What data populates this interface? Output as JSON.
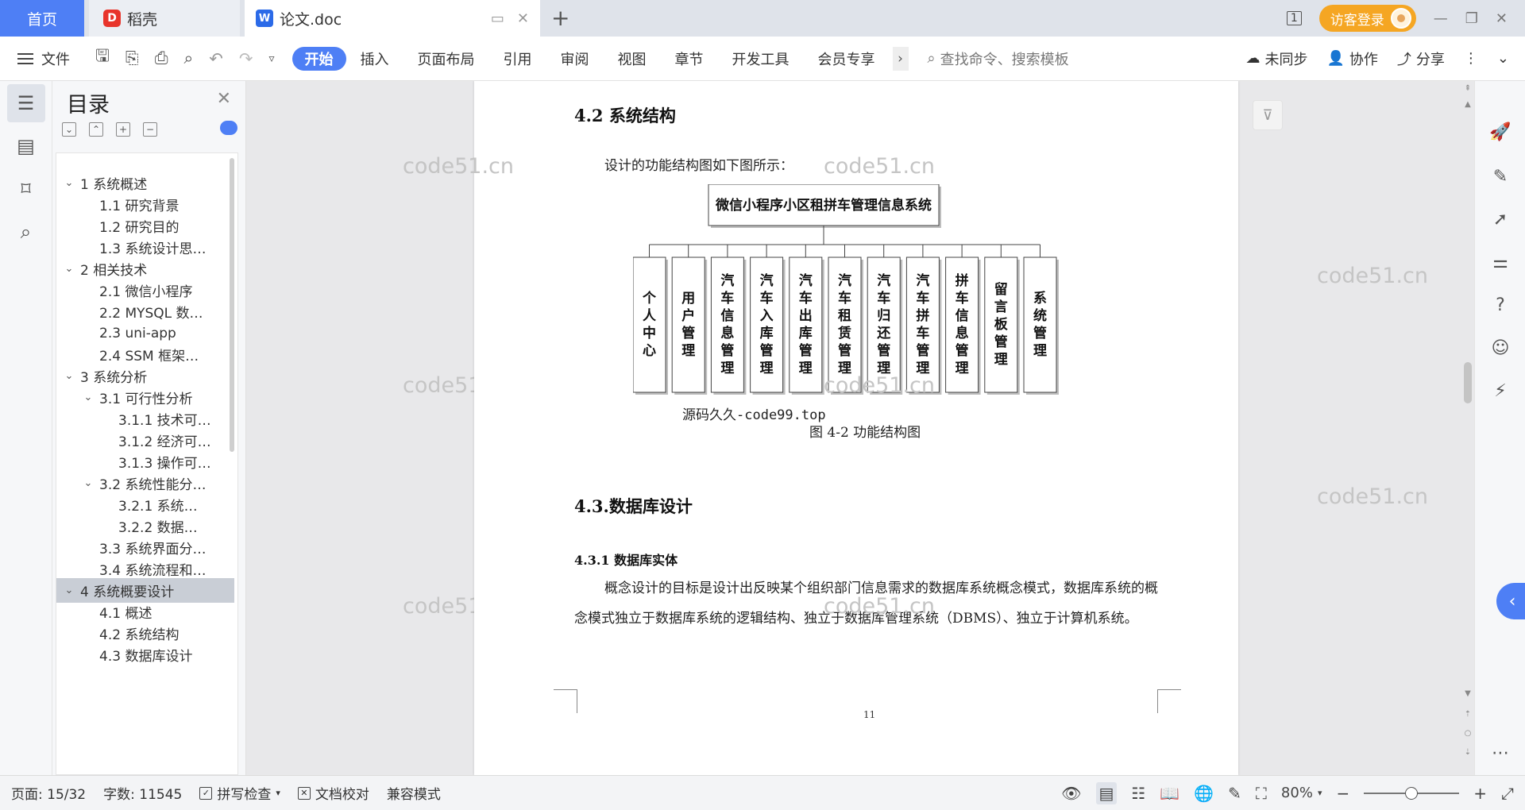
{
  "tabs": {
    "home": "首页",
    "daoke": "稻壳",
    "doc": "论文.doc",
    "new": "+"
  },
  "titlebar": {
    "visitor_login": "访客登录",
    "page_indicator": "1"
  },
  "ribbon": {
    "file": "文件",
    "tabs": [
      "开始",
      "插入",
      "页面布局",
      "引用",
      "审阅",
      "视图",
      "章节",
      "开发工具",
      "会员专享"
    ],
    "active_tab": "开始",
    "search_placeholder": "查找命令、搜索模板",
    "unsynced": "未同步",
    "collaborate": "协作",
    "share": "分享"
  },
  "toc": {
    "title": "目录",
    "items": [
      {
        "label": "1 系统概述",
        "level": 1,
        "expanded": true
      },
      {
        "label": "1.1  研究背景",
        "level": 2
      },
      {
        "label": "1.2 研究目的",
        "level": 2
      },
      {
        "label": "1.3 系统设计思…",
        "level": 2
      },
      {
        "label": "2 相关技术",
        "level": 1,
        "expanded": true
      },
      {
        "label": "2.1 微信小程序",
        "level": 2
      },
      {
        "label": "2.2 MYSQL 数…",
        "level": 2
      },
      {
        "label": "2.3 uni-app",
        "level": 2
      },
      {
        "label": "2.4 SSM 框架…",
        "level": 2
      },
      {
        "label": "3 系统分析",
        "level": 1,
        "expanded": true
      },
      {
        "label": "3.1 可行性分析",
        "level": 2,
        "expanded": true
      },
      {
        "label": "3.1.1 技术可…",
        "level": 3
      },
      {
        "label": "3.1.2 经济可…",
        "level": 3
      },
      {
        "label": "3.1.3 操作可…",
        "level": 3
      },
      {
        "label": "3.2 系统性能分…",
        "level": 2,
        "expanded": true
      },
      {
        "label": "3.2.1  系统…",
        "level": 3
      },
      {
        "label": "3.2.2  数据…",
        "level": 3
      },
      {
        "label": "3.3 系统界面分…",
        "level": 2
      },
      {
        "label": "3.4 系统流程和…",
        "level": 2
      },
      {
        "label": "4 系统概要设计",
        "level": 1,
        "expanded": true,
        "selected": true
      },
      {
        "label": "4.1 概述",
        "level": 2
      },
      {
        "label": "4.2 系统结构",
        "level": 2
      },
      {
        "label": "4.3 数据库设计",
        "level": 2
      }
    ]
  },
  "document": {
    "heading_42": "4.2 系统结构",
    "figure_intro": "设计的功能结构图如下图所示：",
    "diagram_root": "微信小程序小区租拼车管理信息系统",
    "diagram_children": [
      "个人中心",
      "用户管理",
      "汽车信息管理",
      "汽车入库管理",
      "汽车出库管理",
      "汽车租赁管理",
      "汽车归还管理",
      "汽车拼车管理",
      "拼车信息管理",
      "留言板管理",
      "系统管理"
    ],
    "figure_source_note": "源码久久-code99.top",
    "figure_caption": "图 4-2 功能结构图",
    "heading_43": "4.3.数据库设计",
    "heading_431": "4.3.1 数据库实体",
    "paragraph": "概念设计的目标是设计出反映某个组织部门信息需求的数据库系统概念模式，数据库系统的概念模式独立于数据库系统的逻辑结构、独立于数据库管理系统（DBMS）、独立于计算机系统。",
    "page_number": "11",
    "watermark": "code51.cn"
  },
  "statusbar": {
    "page": "页面: 15/32",
    "words": "字数: 11545",
    "spellcheck": "拼写检查",
    "proofread": "文档校对",
    "compat": "兼容模式",
    "zoom": "80%",
    "zoom_level": 0.5
  },
  "colors": {
    "accent": "#4e7ff5",
    "visitor": "#f5a623"
  }
}
